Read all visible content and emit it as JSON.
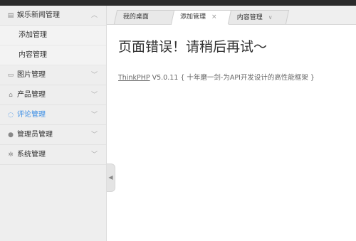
{
  "sidebar": {
    "items": [
      {
        "label": "娱乐新闻管理",
        "icon": "document-icon",
        "expanded": true,
        "children": [
          {
            "label": "添加管理"
          },
          {
            "label": "内容管理"
          }
        ]
      },
      {
        "label": "图片管理",
        "icon": "image-icon"
      },
      {
        "label": "产品管理",
        "icon": "bag-icon"
      },
      {
        "label": "评论管理",
        "icon": "comment-icon",
        "highlight_color": "#3a8ee6"
      },
      {
        "label": "管理员管理",
        "icon": "user-icon"
      },
      {
        "label": "系统管理",
        "icon": "gear-icon"
      }
    ]
  },
  "tabs": [
    {
      "label": "我的桌面"
    },
    {
      "label": "添加管理",
      "close": "×",
      "active": true
    },
    {
      "label": "内容管理",
      "dropdown": "∨"
    }
  ],
  "main": {
    "error_title": "页面错误！请稍后再试～",
    "footer_link": "ThinkPHP",
    "footer_text": " V5.0.11 { 十年磨一剑-为API开发设计的高性能框架 }"
  }
}
